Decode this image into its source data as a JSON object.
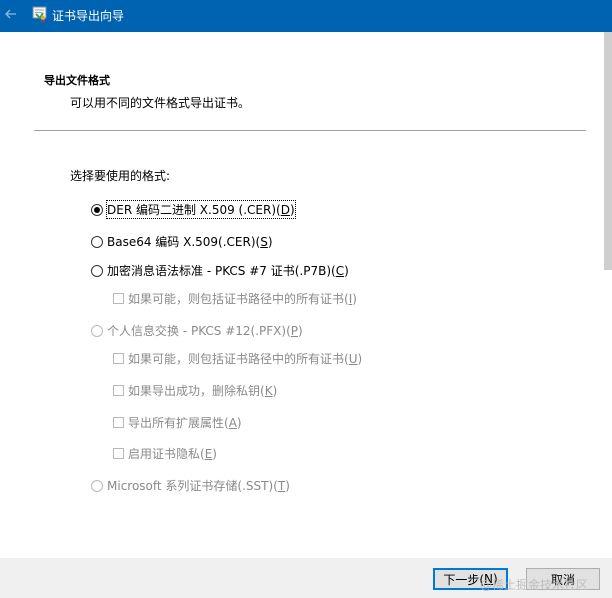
{
  "window": {
    "title": "证书导出向导"
  },
  "header": {
    "title": "导出文件格式",
    "subtitle": "可以用不同的文件格式导出证书。"
  },
  "prompt": "选择要使用的格式:",
  "options": {
    "der": {
      "label": "DER 编码二进制 X.509 (.CER)(",
      "key": "D",
      "suffix": ")",
      "selected": true,
      "enabled": true
    },
    "base64": {
      "label": "Base64 编码 X.509(.CER)(",
      "key": "S",
      "suffix": ")",
      "selected": false,
      "enabled": true
    },
    "pkcs7": {
      "label": "加密消息语法标准 - PKCS #7 证书(.P7B)(",
      "key": "C",
      "suffix": ")",
      "selected": false,
      "enabled": true
    },
    "pkcs7_include": {
      "label": "如果可能，则包括证书路径中的所有证书(",
      "key": "I",
      "suffix": ")",
      "checked": false,
      "enabled": false
    },
    "pfx": {
      "label": "个人信息交换 - PKCS #12(.PFX)(",
      "key": "P",
      "suffix": ")",
      "selected": false,
      "enabled": false
    },
    "pfx_include": {
      "label": "如果可能，则包括证书路径中的所有证书(",
      "key": "U",
      "suffix": ")",
      "checked": false,
      "enabled": false
    },
    "pfx_delete_key": {
      "label": "如果导出成功，删除私钥(",
      "key": "K",
      "suffix": ")",
      "checked": false,
      "enabled": false
    },
    "pfx_export_props": {
      "label": "导出所有扩展属性(",
      "key": "A",
      "suffix": ")",
      "checked": false,
      "enabled": false
    },
    "pfx_privacy": {
      "label": "启用证书隐私(",
      "key": "E",
      "suffix": ")",
      "checked": false,
      "enabled": false
    },
    "sst": {
      "label": "Microsoft 系列证书存储(.SST)(",
      "key": "T",
      "suffix": ")",
      "selected": false,
      "enabled": false
    }
  },
  "buttons": {
    "next": {
      "label": "下一步(",
      "key": "N",
      "suffix": ")"
    },
    "cancel": {
      "label": "取消"
    }
  },
  "watermark": "@稀土掘金技术社区",
  "colors": {
    "titlebar": "#0063b1",
    "focus_border": "#0078d7",
    "disabled_text": "#8a8a8a"
  }
}
